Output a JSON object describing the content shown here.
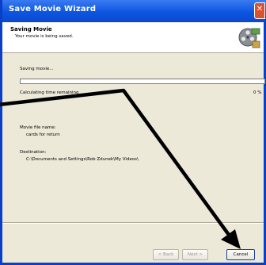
{
  "window": {
    "title": "Save Movie Wizard"
  },
  "header": {
    "title": "Saving Movie",
    "subtitle": "Your movie is being saved."
  },
  "main": {
    "status_label": "Saving movie...",
    "progress_label": "Calculating time remaining",
    "progress_percent_text": "0 %",
    "progress_fraction": 0,
    "movie_file_name_label": "Movie file name:",
    "movie_file_name_value": "cards for return",
    "destination_label": "Destination:",
    "destination_value": "C:\\Documents and Settings\\Rob Zdunek\\My Videos\\"
  },
  "footer": {
    "back_label": "< Back",
    "next_label": "Next >",
    "cancel_label": "Cancel"
  },
  "colors": {
    "titlebar": "#0c55e0",
    "annotation_arrow": "#000000",
    "progress_fill": "#2f9a2f"
  },
  "icons": {
    "close": "close-icon",
    "header": "movie-film-reel-icon"
  }
}
